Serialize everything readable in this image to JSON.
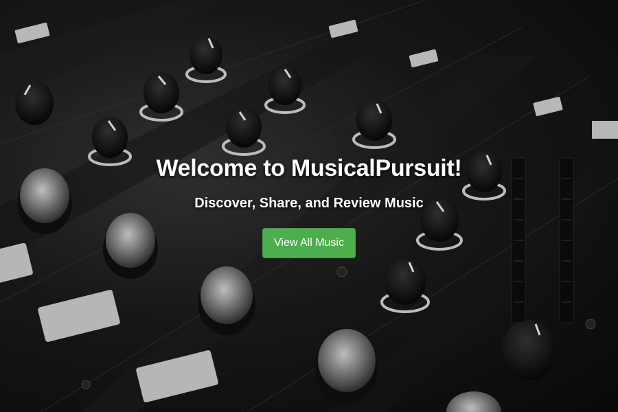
{
  "hero": {
    "background_image": "dj-mixer-console-photo",
    "title": "Welcome to MusicalPursuit!",
    "subtitle": "Discover, Share, and Review Music",
    "cta_label": "View All Music",
    "cta_color": "#4cae4c"
  }
}
